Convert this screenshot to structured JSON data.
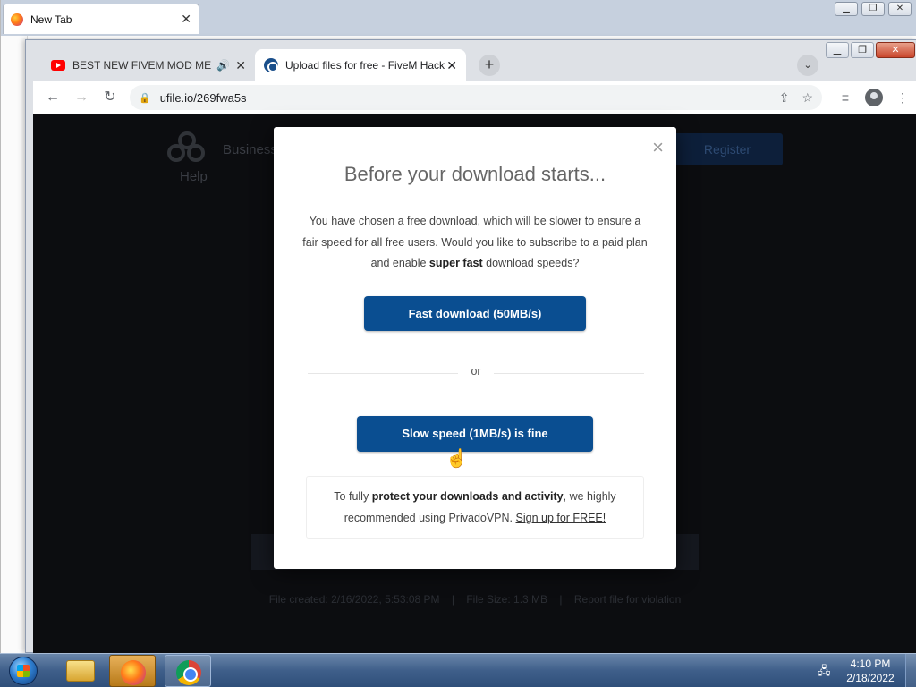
{
  "firefox": {
    "tab_label": "New Tab"
  },
  "chrome": {
    "tabs": [
      {
        "label": "BEST NEW FIVEM MOD MENU",
        "audio": "🔊"
      },
      {
        "label": "Upload files for free - FiveM Hack"
      }
    ],
    "url": "ufile.io/269fwa5s"
  },
  "site": {
    "nav_business": "Business",
    "nav_help": "Help",
    "register": "Register",
    "footer": {
      "created": "File created: 2/16/2022, 5:53:08 PM",
      "size": "File Size: 1.3 MB",
      "report": "Report file for violation",
      "separator": "|"
    }
  },
  "modal": {
    "close": "×",
    "title": "Before your download starts...",
    "desc_part1": "You have chosen a free download, which will be slower to ensure a fair speed for all free users. Would you like to subscribe to a paid plan and enable ",
    "desc_bold": "super fast",
    "desc_part2": " download speeds?",
    "fast_button": "Fast download (50MB/s)",
    "or": "or",
    "slow_button": "Slow speed (1MB/s) is fine",
    "vpn_part1": "To fully ",
    "vpn_bold": "protect your downloads and activity",
    "vpn_part2": ", we highly recommended using PrivadoVPN. ",
    "vpn_link": "Sign up for FREE!"
  },
  "taskbar": {
    "time": "4:10 PM",
    "date": "2/18/2022"
  },
  "icons": {
    "accent": "#0a4e91"
  }
}
